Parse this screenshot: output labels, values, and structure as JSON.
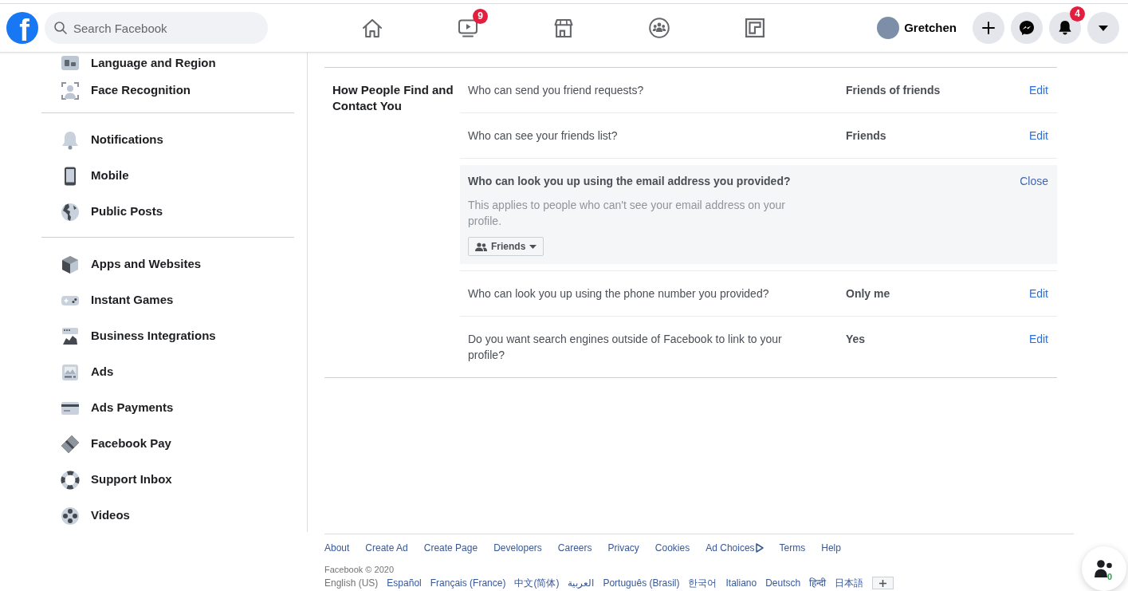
{
  "header": {
    "logo": "f",
    "search": {
      "placeholder": "Search Facebook"
    },
    "nav_tabs": [
      {
        "kind": "home",
        "selected": false
      },
      {
        "kind": "watch",
        "selected": false,
        "badge": "9"
      },
      {
        "kind": "marketplace",
        "selected": false
      },
      {
        "kind": "groups",
        "selected": false
      },
      {
        "kind": "gaming",
        "selected": false
      }
    ],
    "profile": {
      "name": "Gretchen"
    },
    "actions": [
      {
        "kind": "create"
      },
      {
        "kind": "messenger"
      },
      {
        "kind": "notifications",
        "badge": "4"
      },
      {
        "kind": "account"
      }
    ]
  },
  "sidebar": {
    "sections": [
      {
        "items": [
          {
            "kind": "language",
            "label": "Language and Region",
            "selected": false
          },
          {
            "kind": "face",
            "label": "Face Recognition",
            "selected": false
          }
        ]
      },
      {
        "items": [
          {
            "kind": "notifications",
            "label": "Notifications",
            "selected": false
          },
          {
            "kind": "mobile",
            "label": "Mobile",
            "selected": false
          },
          {
            "kind": "public",
            "label": "Public Posts",
            "selected": false
          }
        ]
      },
      {
        "items": [
          {
            "kind": "apps",
            "label": "Apps and Websites",
            "selected": false
          },
          {
            "kind": "games",
            "label": "Instant Games",
            "selected": false
          },
          {
            "kind": "business",
            "label": "Business Integrations",
            "selected": false
          },
          {
            "kind": "ads",
            "label": "Ads",
            "selected": false
          },
          {
            "kind": "payments",
            "label": "Ads Payments",
            "selected": false
          },
          {
            "kind": "pay",
            "label": "Facebook Pay",
            "selected": false
          },
          {
            "kind": "support",
            "label": "Support Inbox",
            "selected": false
          },
          {
            "kind": "videos",
            "label": "Videos",
            "selected": false
          }
        ]
      }
    ]
  },
  "settings": {
    "section_title": "How People Find and Contact You",
    "rows": [
      {
        "question": "Who can send you friend requests?",
        "value": "Friends of friends",
        "action": "Edit",
        "expanded": false
      },
      {
        "question": "Who can see your friends list?",
        "value": "Friends",
        "action": "Edit",
        "expanded": false
      },
      {
        "question": "Who can look you up using the email address you provided?",
        "description": "This applies to people who can't see your email address on your profile.",
        "audience": "Friends",
        "action": "Close",
        "expanded": true
      },
      {
        "question": "Who can look you up using the phone number you provided?",
        "value": "Only me",
        "action": "Edit",
        "expanded": false
      },
      {
        "question": "Do you want search engines outside of Facebook to link to your profile?",
        "value": "Yes",
        "action": "Edit",
        "expanded": false
      }
    ]
  },
  "footer": {
    "links": [
      {
        "kind": "text",
        "label": "About"
      },
      {
        "kind": "text",
        "label": "Create Ad"
      },
      {
        "kind": "text",
        "label": "Create Page"
      },
      {
        "kind": "text",
        "label": "Developers"
      },
      {
        "kind": "text",
        "label": "Careers"
      },
      {
        "kind": "text",
        "label": "Privacy"
      },
      {
        "kind": "text",
        "label": "Cookies"
      },
      {
        "kind": "ad_choices",
        "label": "Ad Choices"
      },
      {
        "kind": "text",
        "label": "Terms"
      },
      {
        "kind": "text",
        "label": "Help"
      }
    ],
    "copyright": "Facebook © 2020",
    "languages": [
      {
        "label": "English (US)",
        "selected": true
      },
      {
        "label": "Español",
        "selected": false
      },
      {
        "label": "Français (France)",
        "selected": false
      },
      {
        "label": "中文(简体)",
        "selected": false
      },
      {
        "label": "العربية",
        "selected": false
      },
      {
        "label": "Português (Brasil)",
        "selected": false
      },
      {
        "label": "한국어",
        "selected": false
      },
      {
        "label": "Italiano",
        "selected": false
      },
      {
        "label": "Deutsch",
        "selected": false
      },
      {
        "label": "हिन्दी",
        "selected": false
      },
      {
        "label": "日本語",
        "selected": false
      }
    ]
  },
  "contacts_button": {
    "badge": "0"
  }
}
